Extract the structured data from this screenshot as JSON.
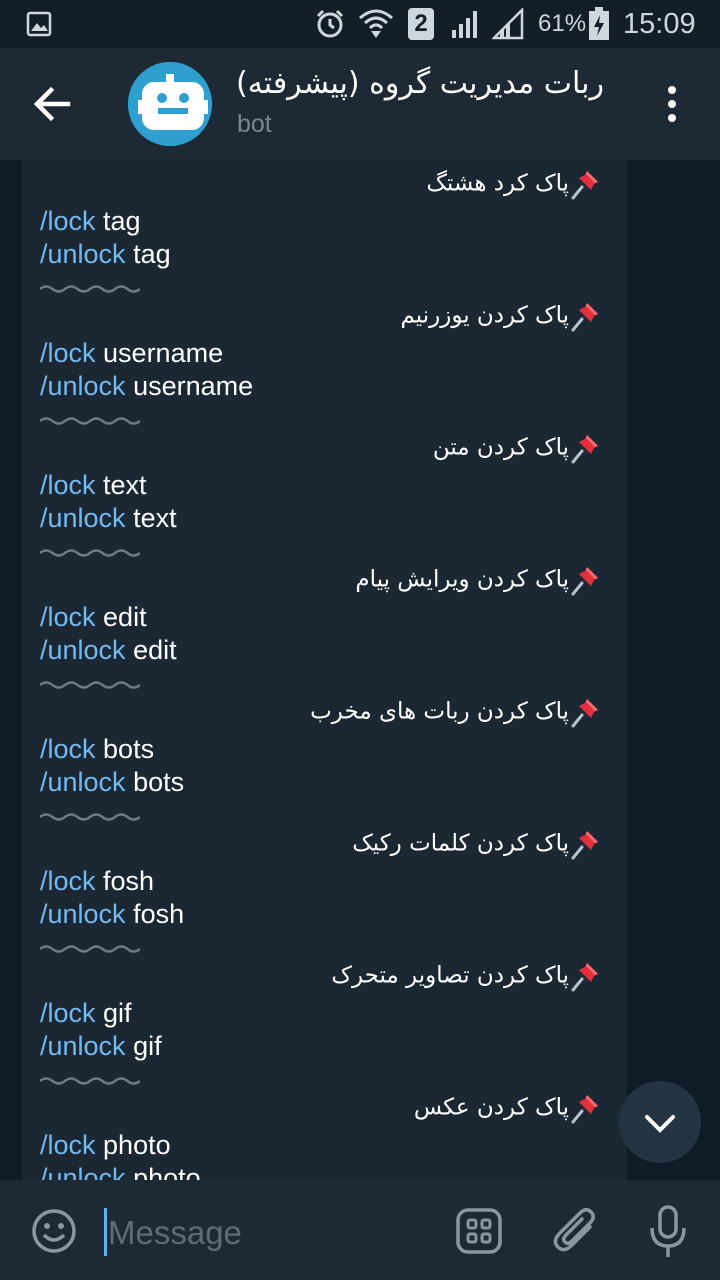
{
  "status_bar": {
    "sim_badge": "2",
    "battery_percent": "61%",
    "time": "15:09"
  },
  "header": {
    "title": "ربات مدیریت گروه (پیشرفته)",
    "subtitle": "bot"
  },
  "message": {
    "sections": [
      {
        "heading": "پاک کرد هشتگ",
        "lock_cmd": "/lock",
        "lock_arg": " tag",
        "unlock_cmd": "/unlock",
        "unlock_arg": " tag"
      },
      {
        "heading": "پاک کردن یوزرنیم",
        "lock_cmd": "/lock",
        "lock_arg": " username",
        "unlock_cmd": "/unlock",
        "unlock_arg": " username"
      },
      {
        "heading": "پاک کردن متن",
        "lock_cmd": "/lock",
        "lock_arg": " text",
        "unlock_cmd": "/unlock",
        "unlock_arg": " text"
      },
      {
        "heading": "پاک کردن ویرایش پیام",
        "lock_cmd": "/lock",
        "lock_arg": " edit",
        "unlock_cmd": "/unlock",
        "unlock_arg": " edit"
      },
      {
        "heading": "پاک کردن ربات های مخرب",
        "lock_cmd": "/lock",
        "lock_arg": " bots",
        "unlock_cmd": "/unlock",
        "unlock_arg": " bots"
      },
      {
        "heading": "پاک کردن کلمات رکیک",
        "lock_cmd": "/lock",
        "lock_arg": " fosh",
        "unlock_cmd": "/unlock",
        "unlock_arg": " fosh"
      },
      {
        "heading": "پاک کردن تصاویر متحرک",
        "lock_cmd": "/lock",
        "lock_arg": " gif",
        "unlock_cmd": "/unlock",
        "unlock_arg": " gif"
      },
      {
        "heading": "پاک کردن عکس",
        "lock_cmd": "/lock",
        "lock_arg": " photo",
        "unlock_cmd": "/unlock",
        "unlock_arg": " photo"
      }
    ]
  },
  "composer": {
    "placeholder": "Message"
  },
  "icons": {
    "back": "arrow-left-icon",
    "menu": "more-vertical-icon",
    "pin": "pushpin-icon",
    "emoji": "smile-icon",
    "stickers": "sticker-grid-icon",
    "attach": "paperclip-icon",
    "mic": "microphone-icon",
    "scroll_down": "chevron-down-icon"
  },
  "colors": {
    "link": "#71baf2",
    "header_bg": "#1d2a36",
    "bubble_bg": "#1b2733",
    "chat_bg": "#0f1b26"
  }
}
